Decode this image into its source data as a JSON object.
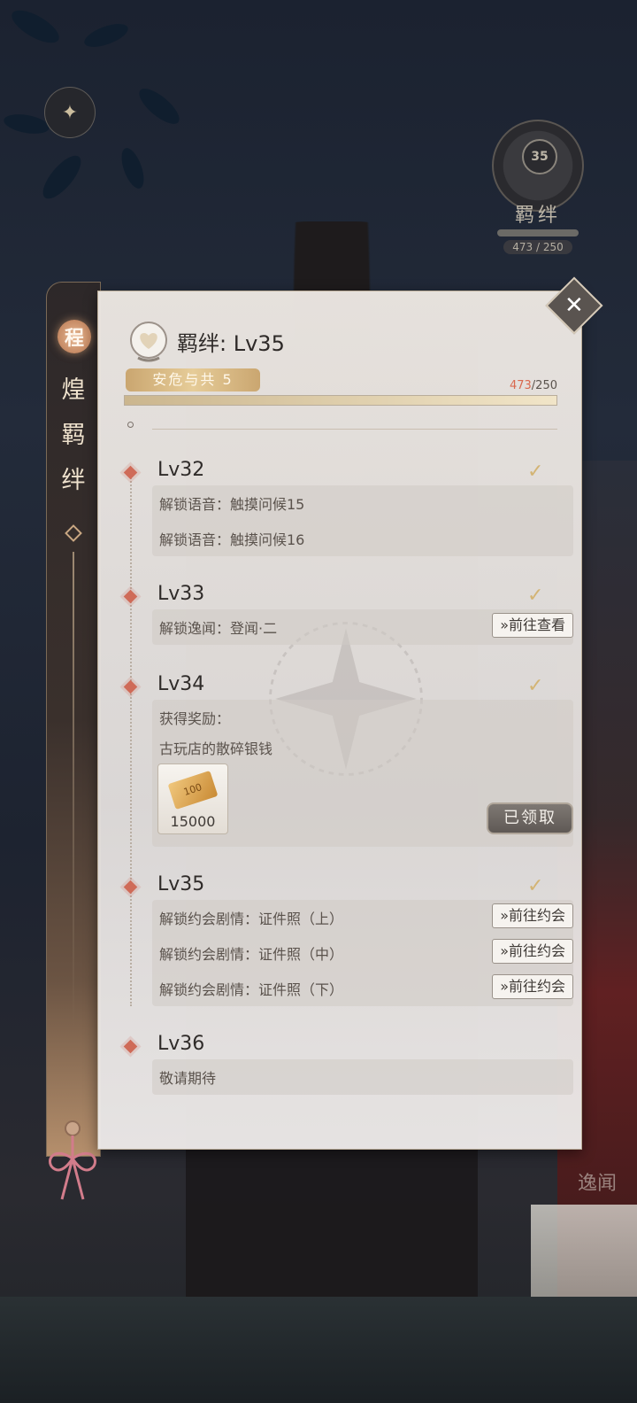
{
  "side_tab": {
    "seal": "程",
    "title_line1": "煌",
    "title_line2": "羁",
    "title_line3": "绊"
  },
  "badge": {
    "level": "35",
    "name": "羁绊",
    "value": "473 / 250"
  },
  "right_nav": {
    "item_3": "逸闻"
  },
  "header": {
    "bond_label": "羁绊",
    "separator": ":",
    "level": "Lv35",
    "stage": "安危与共 5",
    "progress_current": "473",
    "progress_max": "/250",
    "progress_fraction": 1.0
  },
  "levels": [
    {
      "level": "Lv32",
      "rows": [
        {
          "text": "解锁语音：触摸问候15"
        },
        {
          "text": "解锁语音：触摸问候16"
        }
      ]
    },
    {
      "level": "Lv33",
      "rows": [
        {
          "text": "解锁逸闻：登闻·二",
          "action": "»前往查看"
        }
      ]
    },
    {
      "level": "Lv34",
      "rows": [
        {
          "text": "获得奖励："
        },
        {
          "text": "古玩店的散碎银钱"
        }
      ],
      "reward": {
        "quantity": "15000",
        "ticket_text": "100"
      },
      "claimed_label": "已领取"
    },
    {
      "level": "Lv35",
      "rows": [
        {
          "text": "解锁约会剧情：证件照（上）",
          "action": "»前往约会"
        },
        {
          "text": "解锁约会剧情：证件照（中）",
          "action": "»前往约会"
        },
        {
          "text": "解锁约会剧情：证件照（下）",
          "action": "»前往约会"
        }
      ]
    },
    {
      "level": "Lv36",
      "rows": [
        {
          "text": "敬请期待"
        }
      ]
    }
  ],
  "colors": {
    "accent_gold": "#d3b474",
    "marker_red": "#cf6b58",
    "progress_highlight": "#d9694f"
  },
  "icons": {
    "close": "close-icon",
    "check": "check-icon",
    "back": "back-arrow-icon",
    "heart": "heart-icon"
  }
}
